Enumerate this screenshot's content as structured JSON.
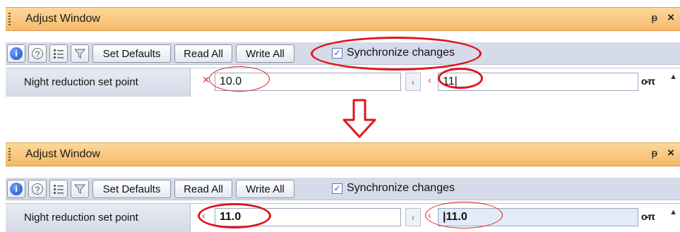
{
  "panels": [
    {
      "title": "Adjust Window",
      "toolbar": {
        "set_defaults": "Set Defaults",
        "read_all": "Read All",
        "write_all": "Write All",
        "sync_label": "Synchronize changes",
        "sync_checked": true
      },
      "row": {
        "label": "Night reduction set point",
        "value_left": "10.0",
        "value_right": "11|"
      }
    },
    {
      "title": "Adjust Window",
      "toolbar": {
        "set_defaults": "Set Defaults",
        "read_all": "Read All",
        "write_all": "Write All",
        "sync_label": "Synchronize changes",
        "sync_checked": true
      },
      "row": {
        "label": "Night reduction set point",
        "value_left": "11.0",
        "value_right": "|11.0"
      }
    }
  ],
  "glyphs": {
    "pin": "ᵽ",
    "close": "×",
    "check": "✓",
    "key": "o-π",
    "scroll_up": "▲",
    "arrow_left": "‹",
    "info": "i",
    "help": "?"
  },
  "colors": {
    "titlebar": "#f6b96a",
    "toolbar": "#d6dbe9",
    "annotation": "#e0141c",
    "edited_field": "#e2ecf8"
  }
}
